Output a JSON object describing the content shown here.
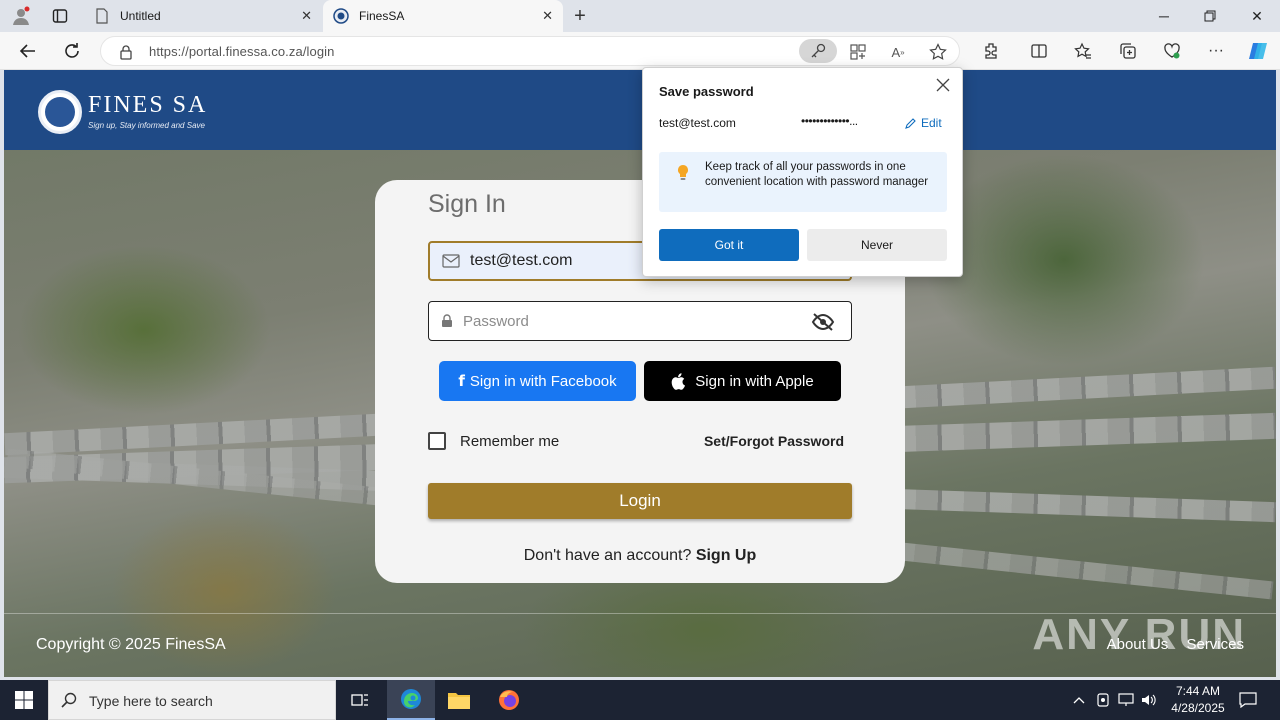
{
  "browser": {
    "tabs": [
      {
        "title": "Untitled"
      },
      {
        "title": "FinesSA"
      }
    ],
    "url": "https://portal.finessa.co.za/login"
  },
  "site": {
    "logo_name": "FINES SA",
    "logo_tagline": "Sign up, Stay informed and Save",
    "signin_title": "Sign In",
    "email_value": "test@test.com",
    "password_placeholder": "Password",
    "facebook_label": "Sign in with Facebook",
    "apple_label": "Sign in with Apple",
    "remember_label": "Remember me",
    "forgot_label": "Set/Forgot Password",
    "login_label": "Login",
    "no_account_text": "Don't have an account?",
    "signup_label": "Sign Up",
    "copyright": "Copyright © 2025 FinesSA",
    "footer_links": [
      "About Us",
      "Services"
    ],
    "watermark": "ANY RUN"
  },
  "save_password_popup": {
    "title": "Save password",
    "username": "test@test.com",
    "password_masked": "•••••••••••••...",
    "edit_label": "Edit",
    "tip_text": "Keep track of all your passwords in one convenient location with password manager",
    "got_it_label": "Got it",
    "never_label": "Never"
  },
  "taskbar": {
    "search_placeholder": "Type here to search",
    "time": "7:44 AM",
    "date": "4/28/2025"
  },
  "colors": {
    "site_header": "#1f4a86",
    "gold_accent": "#a07c2a",
    "facebook_blue": "#1877f2",
    "edge_blue": "#0f6cbd"
  }
}
